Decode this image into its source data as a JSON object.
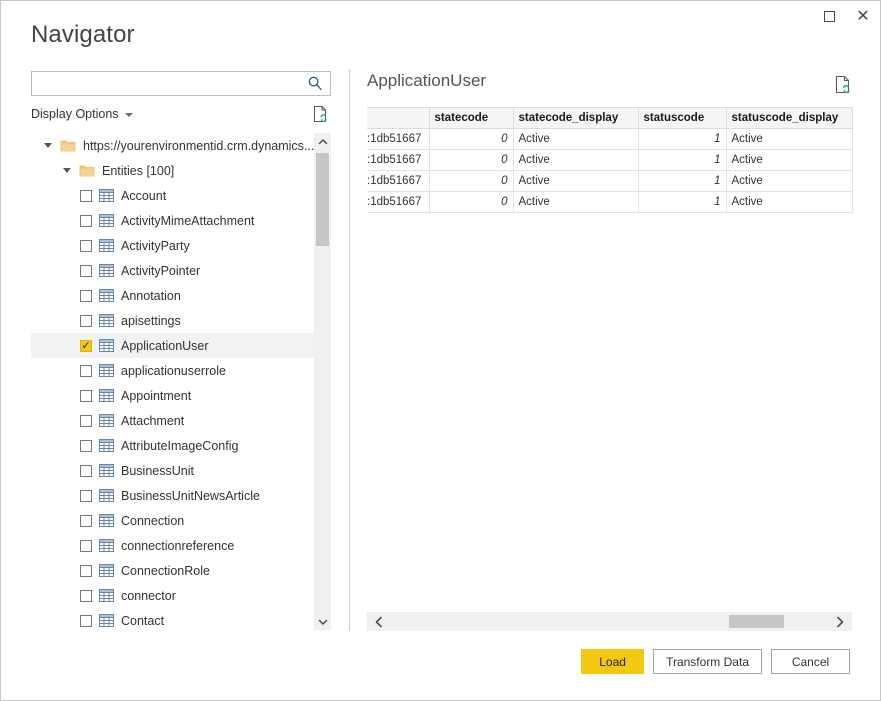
{
  "window": {
    "title": "Navigator",
    "controls": [
      {
        "name": "maximize-button",
        "glyph": "maximize-icon"
      },
      {
        "name": "close-button",
        "glyph": "close-icon"
      }
    ]
  },
  "search": {
    "value": "",
    "placeholder": "",
    "icon": "search-icon"
  },
  "display_options": {
    "label": "Display Options",
    "caret": "chevron-down-icon",
    "refresh_icon": "refresh-document-icon"
  },
  "tree": {
    "items": [
      {
        "label": "https://yourenvironmentid.crm.dynamics...",
        "type": "folder",
        "depth": 0,
        "expanded": true,
        "checked": false,
        "selected": false
      },
      {
        "label": "Entities [100]",
        "type": "folder",
        "depth": 1,
        "expanded": true,
        "checked": false,
        "selected": false
      },
      {
        "label": "Account",
        "type": "table",
        "depth": 2,
        "checked": false,
        "selected": false
      },
      {
        "label": "ActivityMimeAttachment",
        "type": "table",
        "depth": 2,
        "checked": false,
        "selected": false
      },
      {
        "label": "ActivityParty",
        "type": "table",
        "depth": 2,
        "checked": false,
        "selected": false
      },
      {
        "label": "ActivityPointer",
        "type": "table",
        "depth": 2,
        "checked": false,
        "selected": false
      },
      {
        "label": "Annotation",
        "type": "table",
        "depth": 2,
        "checked": false,
        "selected": false
      },
      {
        "label": "apisettings",
        "type": "table",
        "depth": 2,
        "checked": false,
        "selected": false
      },
      {
        "label": "ApplicationUser",
        "type": "table",
        "depth": 2,
        "checked": true,
        "selected": true
      },
      {
        "label": "applicationuserrole",
        "type": "table",
        "depth": 2,
        "checked": false,
        "selected": false
      },
      {
        "label": "Appointment",
        "type": "table",
        "depth": 2,
        "checked": false,
        "selected": false
      },
      {
        "label": "Attachment",
        "type": "table",
        "depth": 2,
        "checked": false,
        "selected": false
      },
      {
        "label": "AttributeImageConfig",
        "type": "table",
        "depth": 2,
        "checked": false,
        "selected": false
      },
      {
        "label": "BusinessUnit",
        "type": "table",
        "depth": 2,
        "checked": false,
        "selected": false
      },
      {
        "label": "BusinessUnitNewsArticle",
        "type": "table",
        "depth": 2,
        "checked": false,
        "selected": false
      },
      {
        "label": "Connection",
        "type": "table",
        "depth": 2,
        "checked": false,
        "selected": false
      },
      {
        "label": "connectionreference",
        "type": "table",
        "depth": 2,
        "checked": false,
        "selected": false
      },
      {
        "label": "ConnectionRole",
        "type": "table",
        "depth": 2,
        "checked": false,
        "selected": false
      },
      {
        "label": "connector",
        "type": "table",
        "depth": 2,
        "checked": false,
        "selected": false
      },
      {
        "label": "Contact",
        "type": "table",
        "depth": 2,
        "checked": false,
        "selected": false
      }
    ]
  },
  "preview": {
    "title": "ApplicationUser",
    "refresh_icon": "refresh-preview-icon",
    "columns": [
      "",
      "statecode",
      "statecode_display",
      "statuscode",
      "statuscode_display"
    ],
    "rows": [
      [
        ":1db51667",
        "0",
        "Active",
        "1",
        "Active"
      ],
      [
        ":1db51667",
        "0",
        "Active",
        "1",
        "Active"
      ],
      [
        ":1db51667",
        "0",
        "Active",
        "1",
        "Active"
      ],
      [
        ":1db51667",
        "0",
        "Active",
        "1",
        "Active"
      ]
    ]
  },
  "footer": {
    "load_label": "Load",
    "transform_label": "Transform Data",
    "cancel_label": "Cancel"
  },
  "colors": {
    "accent": "#f2c811",
    "border": "#c8c8c8",
    "selection": "#f2f2f2",
    "scroll_thumb": "#c6c6c6"
  }
}
